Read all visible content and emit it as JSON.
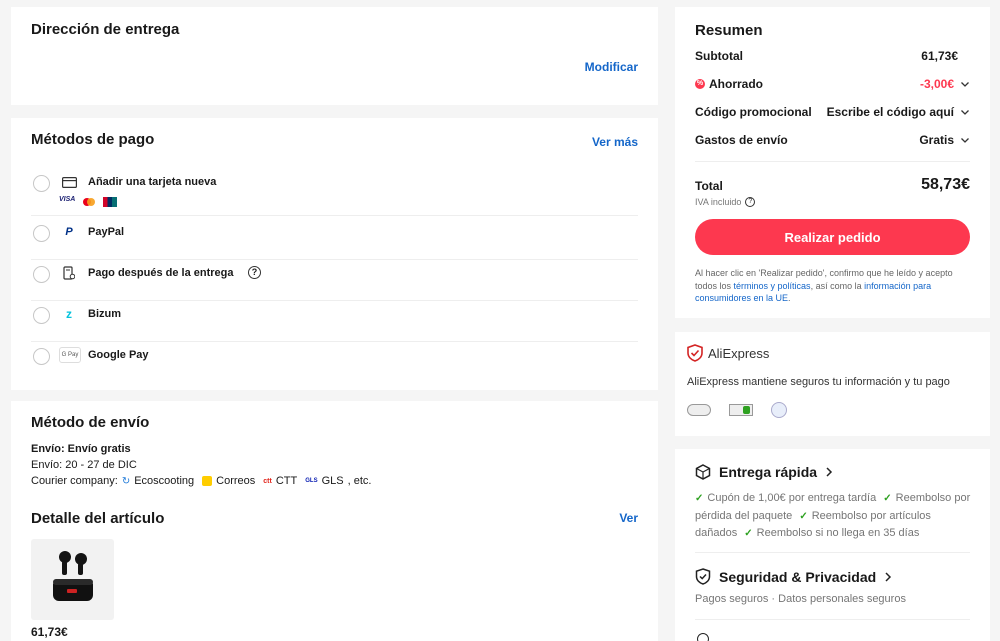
{
  "address": {
    "title": "Dirección de entrega",
    "modify": "Modificar"
  },
  "payment": {
    "title": "Métodos de pago",
    "more": "Ver más",
    "methods": [
      {
        "label": "Añadir una tarjeta nueva",
        "icon": "credit-card-icon"
      },
      {
        "label": "PayPal",
        "icon": "paypal-icon"
      },
      {
        "label": "Pago después de la entrega",
        "icon": "pay-later-icon"
      },
      {
        "label": "Bizum",
        "icon": "bizum-icon"
      },
      {
        "label": "Google Pay",
        "icon": "google-pay-icon"
      }
    ],
    "card_brands": [
      "visa-icon",
      "mastercard-icon",
      "unionpay-icon"
    ],
    "gpay_badge": "G Pay"
  },
  "shipping": {
    "title": "Método de envío",
    "type": "Envío: Envío gratis",
    "dates": "Envío: 20 - 27 de DIC",
    "courier_label": "Courier company:",
    "couriers": [
      "Ecoscooting",
      "Correos",
      "CTT",
      "GLS"
    ],
    "courier_suffix": ", etc."
  },
  "items": {
    "title": "Detalle del artículo",
    "view": "Ver",
    "price": "61,73€"
  },
  "summary": {
    "title": "Resumen",
    "subtotal_label": "Subtotal",
    "subtotal": "61,73€",
    "saved_label": "Ahorrado",
    "saved": "-3,00€",
    "promo_label": "Código promocional",
    "promo_value": "Escribe el código aquí",
    "shipping_label": "Gastos de envío",
    "shipping_value": "Gratis",
    "total_label": "Total",
    "total": "58,73€",
    "vat": "IVA incluido",
    "order_button": "Realizar pedido",
    "legal_1": "Al hacer clic en 'Realizar pedido', confirmo que he leído y acepto todos los ",
    "legal_link1": "términos y políticas",
    "legal_2": ", así como la ",
    "legal_link2": "información para consumidores en la UE",
    "legal_3": "."
  },
  "trust": {
    "brand": "AliExpress",
    "text": "AliExpress mantiene seguros tu información y tu pago",
    "badges": [
      "security-badge-1-icon",
      "security-badge-2-icon",
      "security-badge-3-icon"
    ]
  },
  "fast_delivery": {
    "title": "Entrega rápida",
    "b1": "Cupón de 1,00€ por entrega tardía",
    "b2": "Reembolso por pérdida del paquete",
    "b3": "Reembolso por artículos dañados",
    "b4": "Reembolso si no llega en 35 días"
  },
  "security": {
    "title": "Seguridad & Privacidad",
    "text": "Pagos seguros · Datos personales seguros"
  },
  "colors": {
    "accent": "#fd384f",
    "link": "#1466c9",
    "success": "#2ea121"
  }
}
